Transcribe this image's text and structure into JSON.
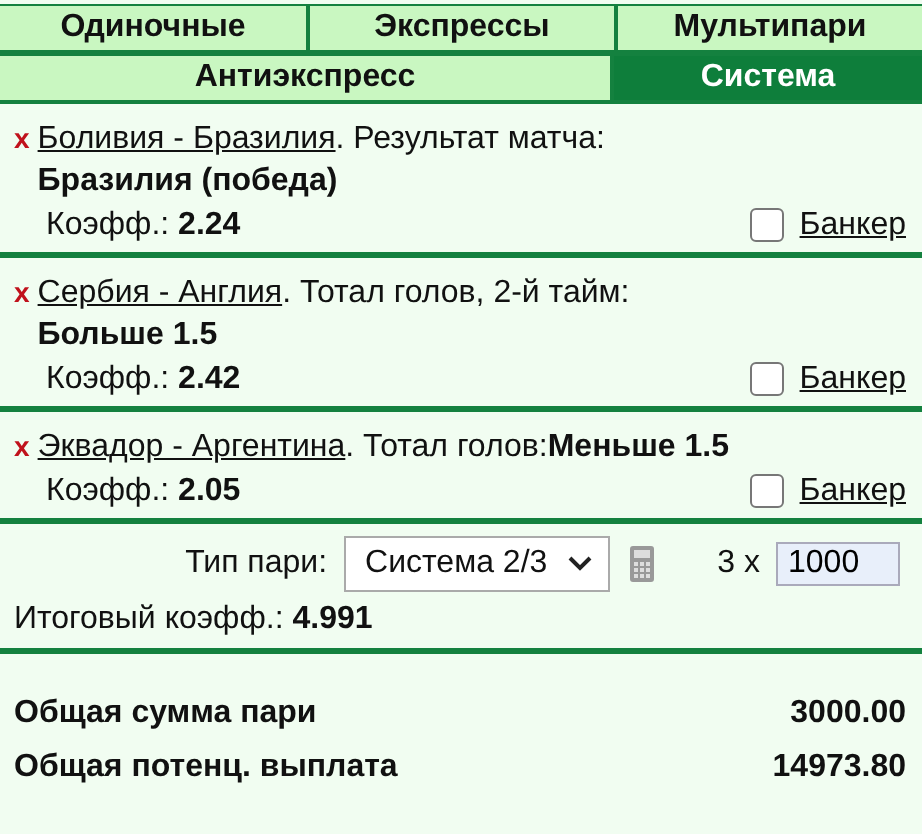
{
  "tabs_top": [
    {
      "label": "Одиночные",
      "selected": false
    },
    {
      "label": "Экспрессы",
      "selected": false
    },
    {
      "label": "Мультипари",
      "selected": false
    }
  ],
  "tabs_bottom": [
    {
      "label": "Антиэкспресс",
      "selected": false
    },
    {
      "label": "Система",
      "selected": true
    }
  ],
  "bets": [
    {
      "remove": "x",
      "event": "Боливия - Бразилия",
      "market": ". Результат матча:",
      "selection": "Бразилия (победа)",
      "kind": "block",
      "odds_label": "Коэфф.:",
      "odds": "2.24",
      "banker_label": "Банкер",
      "banker": false
    },
    {
      "remove": "x",
      "event": "Сербия - Англия",
      "market": ". Тотал голов, 2-й тайм:",
      "selection": "Больше 1.5",
      "kind": "block",
      "odds_label": "Коэфф.:",
      "odds": "2.42",
      "banker_label": "Банкер",
      "banker": false
    },
    {
      "remove": "x",
      "event": "Эквадор - Аргентина",
      "market": ". Тотал голов:",
      "selection": "Меньше 1.5",
      "kind": "inline",
      "odds_label": "Коэфф.:",
      "odds": "2.05",
      "banker_label": "Банкер",
      "banker": false
    }
  ],
  "bet_type": {
    "label": "Тип пари:",
    "value": "Система 2/3",
    "multiplier": "3 x",
    "stake": "1000"
  },
  "total_odds": {
    "label": "Итоговый коэфф.:",
    "value": "4.991"
  },
  "summary": [
    {
      "label": "Общая сумма пари",
      "value": "3000.00"
    },
    {
      "label": "Общая потенц. выплата",
      "value": "14973.80"
    }
  ]
}
